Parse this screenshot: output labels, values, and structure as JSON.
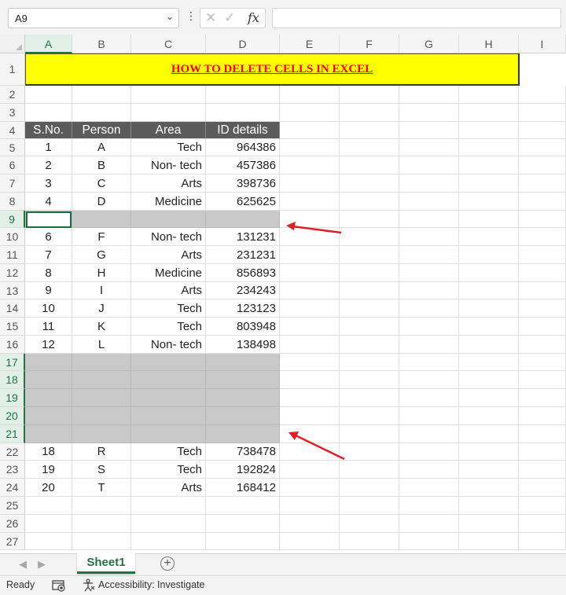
{
  "formula_bar": {
    "name_box": "A9",
    "dropdown_icon": "chevron-down-icon",
    "more_icon": "vertical-ellipsis-icon",
    "cancel_glyph": "✕",
    "enter_glyph": "✓",
    "fx_label": "fx",
    "formula_value": ""
  },
  "columns": [
    "A",
    "B",
    "C",
    "D",
    "E",
    "F",
    "G",
    "H",
    "I"
  ],
  "selected_column": "A",
  "rows": [
    "1",
    "2",
    "3",
    "4",
    "5",
    "6",
    "7",
    "8",
    "9",
    "10",
    "11",
    "12",
    "13",
    "14",
    "15",
    "16",
    "17",
    "18",
    "19",
    "20",
    "21",
    "22",
    "23",
    "24",
    "25",
    "26",
    "27"
  ],
  "selected_rows": [
    "9",
    "17",
    "18",
    "19",
    "20",
    "21"
  ],
  "title": "HOW TO DELETE CELLS IN EXCEL",
  "table": {
    "headers": [
      "S.No.",
      "Person",
      "Area",
      "ID details"
    ],
    "rows": [
      {
        "row": "5",
        "cells": [
          "1",
          "A",
          "Tech",
          "964386"
        ]
      },
      {
        "row": "6",
        "cells": [
          "2",
          "B",
          "Non- tech",
          "457386"
        ]
      },
      {
        "row": "7",
        "cells": [
          "3",
          "C",
          "Arts",
          "398736"
        ]
      },
      {
        "row": "8",
        "cells": [
          "4",
          "D",
          "Medicine",
          "625625"
        ]
      },
      {
        "row": "10",
        "cells": [
          "6",
          "F",
          "Non- tech",
          "131231"
        ]
      },
      {
        "row": "11",
        "cells": [
          "7",
          "G",
          "Arts",
          "231231"
        ]
      },
      {
        "row": "12",
        "cells": [
          "8",
          "H",
          "Medicine",
          "856893"
        ]
      },
      {
        "row": "13",
        "cells": [
          "9",
          "I",
          "Arts",
          "234243"
        ]
      },
      {
        "row": "14",
        "cells": [
          "10",
          "J",
          "Tech",
          "123123"
        ]
      },
      {
        "row": "15",
        "cells": [
          "11",
          "K",
          "Tech",
          "803948"
        ]
      },
      {
        "row": "16",
        "cells": [
          "12",
          "L",
          "Non- tech",
          "138498"
        ]
      },
      {
        "row": "22",
        "cells": [
          "18",
          "R",
          "Tech",
          "738478"
        ]
      },
      {
        "row": "23",
        "cells": [
          "19",
          "S",
          "Tech",
          "192824"
        ]
      },
      {
        "row": "24",
        "cells": [
          "20",
          "T",
          "Arts",
          "168412"
        ]
      }
    ]
  },
  "highlighted_blank_rows": [
    "9",
    "17",
    "18",
    "19",
    "20",
    "21"
  ],
  "sheet_tabs": {
    "prev_glyph": "◀",
    "next_glyph": "▶",
    "active": "Sheet1",
    "add_glyph": "+"
  },
  "status_bar": {
    "ready": "Ready",
    "accessibility": "Accessibility: Investigate"
  },
  "colors": {
    "title_fill": "#ffff00",
    "title_text": "#ff0000",
    "header_fill": "#5b5b5b",
    "blank_fill": "#c9c9c9",
    "excel_green": "#217346",
    "annotation_arrow": "#e02020"
  }
}
